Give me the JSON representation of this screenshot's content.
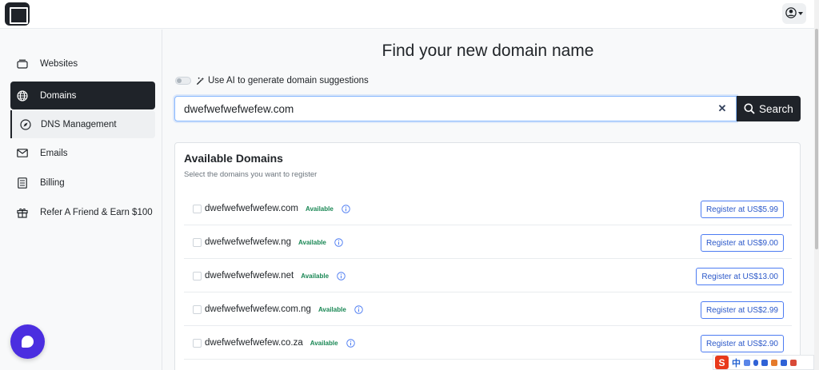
{
  "header": {
    "logo": "app-logo",
    "user_icon": "user-circle-icon"
  },
  "sidebar": {
    "items": [
      {
        "label": "Websites",
        "icon": "window-icon"
      },
      {
        "label": "Domains",
        "icon": "globe-icon",
        "active": true
      },
      {
        "label": "DNS Management",
        "icon": "compass-icon",
        "sub": true
      },
      {
        "label": "Emails",
        "icon": "envelope-icon"
      },
      {
        "label": "Billing",
        "icon": "receipt-icon"
      },
      {
        "label": "Refer A Friend & Earn $100",
        "icon": "gift-icon"
      }
    ]
  },
  "main": {
    "title": "Find your new domain name",
    "ai_toggle_label": "Use AI to generate domain suggestions",
    "ai_toggle_on": false,
    "search": {
      "value": "dwefwefwefwefew.com",
      "button_label": "Search"
    },
    "available": {
      "title": "Available Domains",
      "subtitle": "Select the domains you want to register",
      "rows": [
        {
          "domain": "dwefwefwefwefew.com",
          "status": "Available",
          "button": "Register at US$5.99"
        },
        {
          "domain": "dwefwefwefwefew.ng",
          "status": "Available",
          "button": "Register at US$9.00"
        },
        {
          "domain": "dwefwefwefwefew.net",
          "status": "Available",
          "button": "Register at US$13.00"
        },
        {
          "domain": "dwefwefwefwefew.com.ng",
          "status": "Available",
          "button": "Register at US$2.99"
        },
        {
          "domain": "dwefwefwefwefew.co.za",
          "status": "Available",
          "button": "Register at US$2.90"
        }
      ]
    }
  },
  "ime": {
    "logo": "S",
    "lang": "中"
  },
  "colors": {
    "primary_dark": "#1f2329",
    "available_green": "#198754",
    "register_blue": "#2b58c9",
    "chat_purple": "#4b2ee0"
  }
}
